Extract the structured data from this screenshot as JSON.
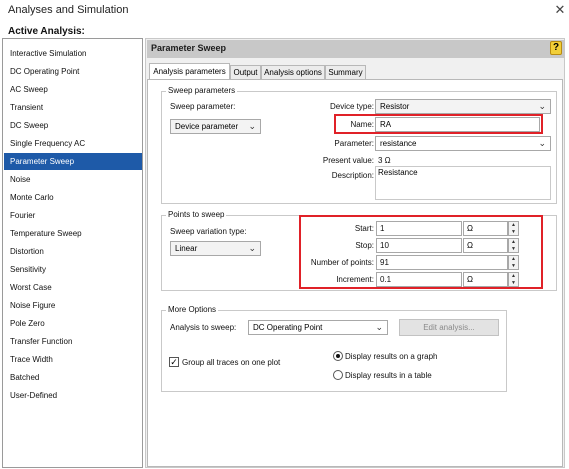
{
  "window": {
    "title": "Analyses and Simulation",
    "close_glyph": "✕"
  },
  "active_analysis_label": "Active Analysis:",
  "analyses": [
    "Interactive Simulation",
    "DC Operating Point",
    "AC Sweep",
    "Transient",
    "DC Sweep",
    "Single Frequency AC",
    "Parameter Sweep",
    "Noise",
    "Monte Carlo",
    "Fourier",
    "Temperature Sweep",
    "Distortion",
    "Sensitivity",
    "Worst Case",
    "Noise Figure",
    "Pole Zero",
    "Transfer Function",
    "Trace Width",
    "Batched",
    "User-Defined"
  ],
  "selected_analysis_index": 6,
  "panel": {
    "title": "Parameter Sweep",
    "help_glyph": "?"
  },
  "tabs": [
    "Analysis parameters",
    "Output",
    "Analysis options",
    "Summary"
  ],
  "active_tab_index": 0,
  "sweep_parameters": {
    "group_label": "Sweep parameters",
    "sweep_parameter_label": "Sweep parameter:",
    "sweep_parameter_value": "Device parameter",
    "device_type_label": "Device type:",
    "device_type_value": "Resistor",
    "name_label": "Name:",
    "name_value": "RA",
    "parameter_label": "Parameter:",
    "parameter_value": "resistance",
    "present_value_label": "Present value:",
    "present_value": "3 Ω",
    "description_label": "Description:",
    "description_value": "Resistance"
  },
  "points_to_sweep": {
    "group_label": "Points to sweep",
    "variation_type_label": "Sweep variation type:",
    "variation_type_value": "Linear",
    "start_label": "Start:",
    "start_value": "1",
    "start_unit": "Ω",
    "stop_label": "Stop:",
    "stop_value": "10",
    "stop_unit": "Ω",
    "num_points_label": "Number of points:",
    "num_points_value": "91",
    "increment_label": "Increment:",
    "increment_value": "0.1",
    "increment_unit": "Ω"
  },
  "more_options": {
    "group_label": "More Options",
    "analysis_to_sweep_label": "Analysis to sweep:",
    "analysis_to_sweep_value": "DC Operating Point",
    "edit_analysis_label": "Edit analysis...",
    "group_traces_label": "Group all traces on one plot",
    "group_traces_checked": true,
    "radio_graph_label": "Display results on a graph",
    "radio_table_label": "Display results in a table",
    "selected_display": "graph"
  },
  "icons": {
    "chevron": "⌄",
    "spin_up": "▲",
    "spin_down": "▼",
    "check": "✓"
  },
  "colors": {
    "selection": "#1e5aa8",
    "highlight_box": "#e02128",
    "panel_header": "#c8c8c8"
  }
}
